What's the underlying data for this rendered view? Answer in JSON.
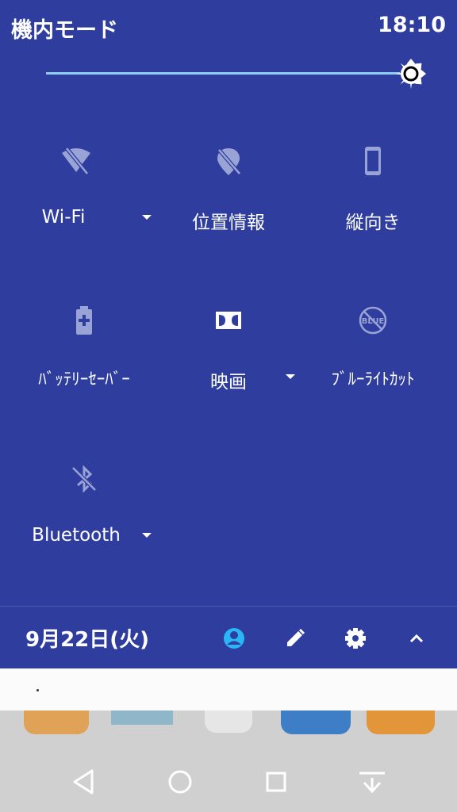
{
  "status_bar": {
    "title": "機内モード",
    "time": "18:10"
  },
  "brightness": {
    "level": 1.0
  },
  "quick_settings": {
    "tiles": [
      {
        "label": "Wi-Fi",
        "icon": "wifi-off-icon",
        "has_dropdown": true
      },
      {
        "label": "位置情報",
        "icon": "location-off-icon",
        "has_dropdown": false
      },
      {
        "label": "縦向き",
        "icon": "portrait-orientation-icon",
        "has_dropdown": false
      },
      {
        "label": "ﾊﾞｯﾃﾘｰｾｰﾊﾞｰ",
        "icon": "battery-saver-icon",
        "has_dropdown": false
      },
      {
        "label": "映画",
        "icon": "dolby-icon",
        "has_dropdown": true
      },
      {
        "label": "ﾌﾞﾙｰﾗｲﾄｶｯﾄ",
        "icon": "blue-light-cut-icon",
        "icon_text": "BLUE",
        "has_dropdown": false
      },
      {
        "label": "Bluetooth",
        "icon": "bluetooth-off-icon",
        "has_dropdown": true
      }
    ]
  },
  "footer": {
    "date": "9月22日(火)",
    "icons": [
      "user-icon",
      "edit-icon",
      "settings-icon",
      "collapse-icon"
    ]
  },
  "colors": {
    "panel": "#2e3d9e",
    "accent": "#29b6f6",
    "slider": "#8fd0f0"
  },
  "nav_bar": {
    "icons": [
      "back-icon",
      "home-icon",
      "recents-icon",
      "notification-pull-icon"
    ]
  }
}
